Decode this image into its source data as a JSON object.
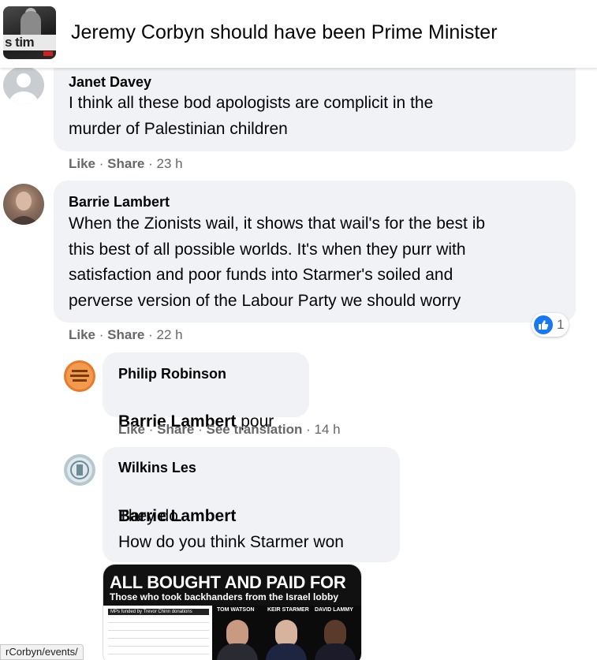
{
  "group": {
    "thumbnail_text": "s tim",
    "title": "Jeremy Corbyn should have been Prime Minister"
  },
  "comments": [
    {
      "author": "Janet Davey",
      "text": "I think all these bod apologists are complicit in the\nmurder of Palestinian children",
      "like_label": "Like",
      "share_label": "Share",
      "time": "23 h"
    },
    {
      "author": "Barrie Lambert",
      "text": "When the Zionists wail, it shows that wail's for the best ib\nthis best of all possible worlds. It's when they purr with\nsatisfaction and poor funds into Starmer's soiled and\nperverse version of the Labour Party we should worry",
      "like_label": "Like",
      "share_label": "Share",
      "time": "22 h",
      "reaction_count": "1"
    }
  ],
  "replies": [
    {
      "author": "Philip Robinson",
      "mention": "Barrie Lambert",
      "text": " pour",
      "like_label": "Like",
      "share_label": "Share",
      "translate_label": "See translation",
      "time": "14 h"
    },
    {
      "author": "Wilkins Les",
      "mention": "Barrie Lambert",
      "text": "They do.\nHow do you think Starmer won"
    }
  ],
  "attachment": {
    "headline": "ALL BOUGHT AND PAID FOR",
    "subheadline": "Those who took backhanders from the Israel lobby",
    "table_caption": "MPs funded by Trevor Chinn donations",
    "names": [
      "TOM WATSON",
      "KEIR STARMER",
      "DAVID LAMMY"
    ]
  },
  "status_bar": {
    "url": "rCorbyn/events/"
  },
  "colors": {
    "bubble": "#f0f2f5",
    "meta": "#65676b",
    "like_blue": "#1877f2"
  }
}
